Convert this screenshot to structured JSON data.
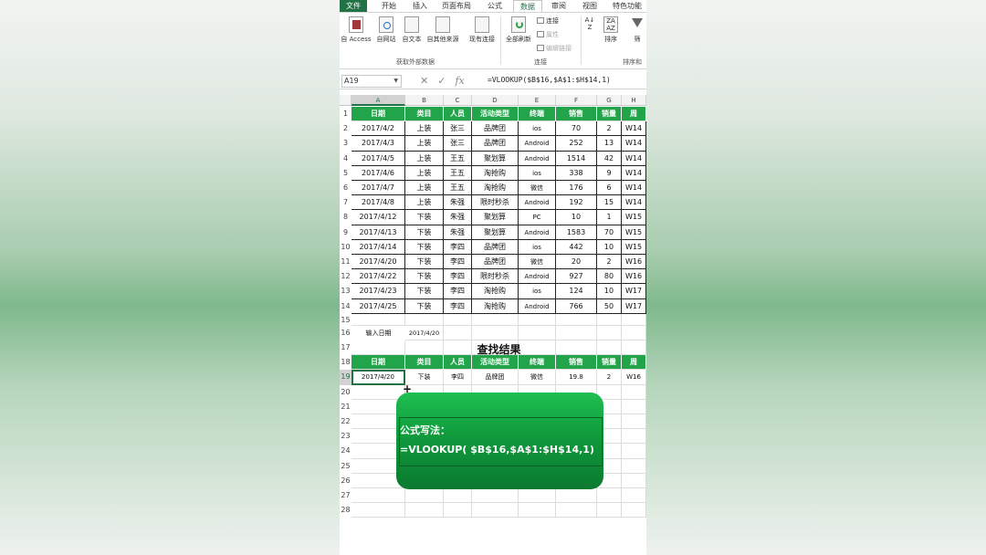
{
  "ribbon": {
    "tabs": [
      "文件",
      "开始",
      "插入",
      "页面布局",
      "公式",
      "数据",
      "审阅",
      "视图",
      "特色功能"
    ],
    "active_tab": "数据",
    "buttons": [
      {
        "label": "自 Access",
        "icon": "access-icon"
      },
      {
        "label": "自网站",
        "icon": "web-icon"
      },
      {
        "label": "自文本",
        "icon": "text-file-icon"
      },
      {
        "label": "自其他来源",
        "icon": "other-sources-icon"
      },
      {
        "label": "现有连接",
        "icon": "existing-connections-icon"
      },
      {
        "label": "全部刷新",
        "icon": "refresh-all-icon"
      },
      {
        "label": "排序",
        "icon": "sort-icon"
      },
      {
        "label": "筛",
        "icon": "filter-icon"
      }
    ],
    "small_buttons": [
      "连接",
      "属性",
      "编辑链接"
    ],
    "groups": [
      "获取外部数据",
      "连接",
      "排序和"
    ]
  },
  "formula_bar": {
    "name_box": "A19",
    "formula": "=VLOOKUP($B$16,$A$1:$H$14,1)"
  },
  "columns": [
    "A",
    "B",
    "C",
    "D",
    "E",
    "F",
    "G",
    "H"
  ],
  "rows": [
    "1",
    "2",
    "3",
    "4",
    "5",
    "6",
    "7",
    "8",
    "9",
    "10",
    "11",
    "12",
    "13",
    "14",
    "15",
    "16",
    "17",
    "18",
    "19",
    "20",
    "21",
    "22",
    "23",
    "24",
    "25",
    "26",
    "27",
    "28"
  ],
  "table": {
    "headers": [
      "日期",
      "类目",
      "人员",
      "活动类型",
      "终端",
      "销售",
      "销量",
      "周"
    ],
    "rows": [
      [
        "2017/4/2",
        "上装",
        "张三",
        "品牌团",
        "ios",
        "70",
        "2",
        "W14"
      ],
      [
        "2017/4/3",
        "上装",
        "张三",
        "品牌团",
        "Android",
        "252",
        "13",
        "W14"
      ],
      [
        "2017/4/5",
        "上装",
        "王五",
        "聚划算",
        "Android",
        "1514",
        "42",
        "W14"
      ],
      [
        "2017/4/6",
        "上装",
        "王五",
        "淘抢购",
        "ios",
        "338",
        "9",
        "W14"
      ],
      [
        "2017/4/7",
        "上装",
        "王五",
        "淘抢购",
        "微信",
        "176",
        "6",
        "W14"
      ],
      [
        "2017/4/8",
        "上装",
        "朱强",
        "限时秒杀",
        "Android",
        "192",
        "15",
        "W14"
      ],
      [
        "2017/4/12",
        "下装",
        "朱强",
        "聚划算",
        "PC",
        "10",
        "1",
        "W15"
      ],
      [
        "2017/4/13",
        "下装",
        "朱强",
        "聚划算",
        "Android",
        "1583",
        "70",
        "W15"
      ],
      [
        "2017/4/14",
        "下装",
        "李四",
        "品牌团",
        "ios",
        "442",
        "10",
        "W15"
      ],
      [
        "2017/4/20",
        "下装",
        "李四",
        "品牌团",
        "微信",
        "20",
        "2",
        "W16"
      ],
      [
        "2017/4/22",
        "下装",
        "李四",
        "限时秒杀",
        "Android",
        "927",
        "80",
        "W16"
      ],
      [
        "2017/4/23",
        "下装",
        "李四",
        "淘抢购",
        "ios",
        "124",
        "10",
        "W17"
      ],
      [
        "2017/4/25",
        "下装",
        "李四",
        "淘抢购",
        "Android",
        "766",
        "50",
        "W17"
      ]
    ]
  },
  "input": {
    "label": "输入日期",
    "value": "2017/4/20"
  },
  "result": {
    "title": "查找结果",
    "headers": [
      "日期",
      "类目",
      "人员",
      "活动类型",
      "终端",
      "销售",
      "销量",
      "周"
    ],
    "row": [
      "2017/4/20",
      "下装",
      "李四",
      "品牌团",
      "微信",
      "19.8",
      "2",
      "W16"
    ]
  },
  "callout": {
    "line1": "公式写法：",
    "line2": "=VLOOKUP( $B$16,$A$1:$H$14,1)"
  },
  "colors": {
    "excel_green": "#217346",
    "header_green": "#22a44a",
    "callout_green": "#0f9a3c"
  }
}
